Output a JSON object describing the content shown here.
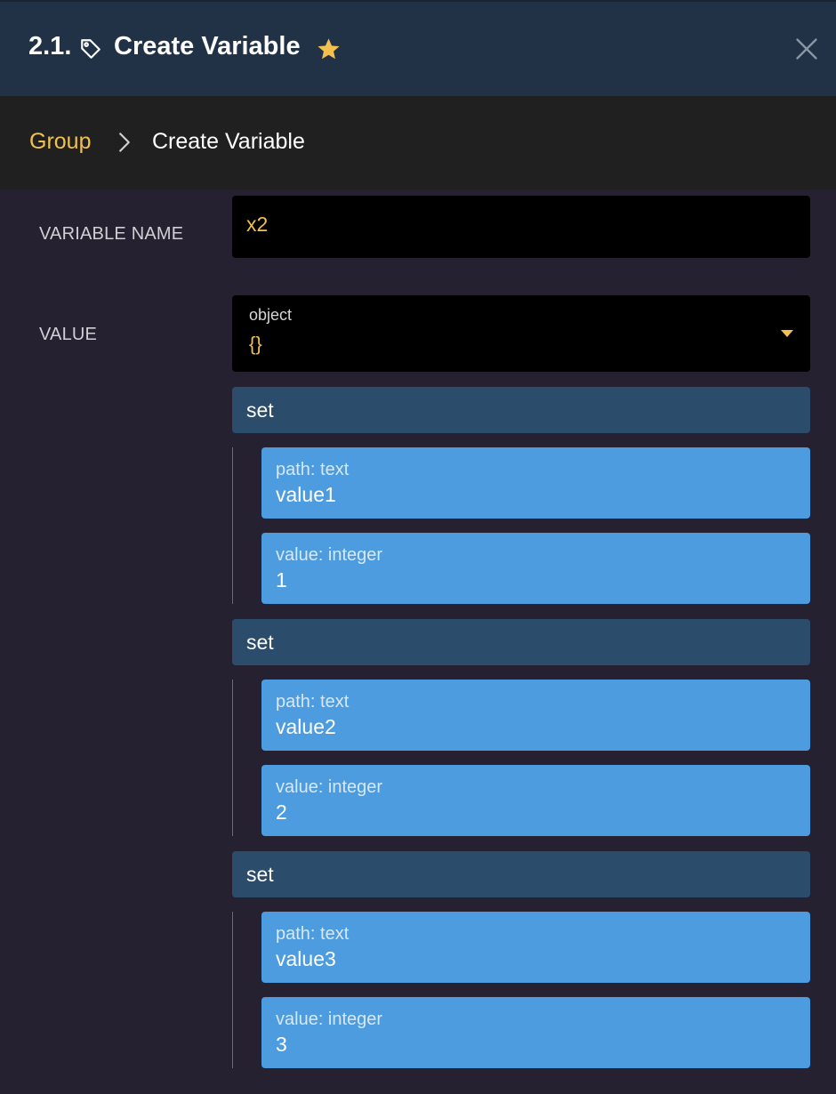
{
  "header": {
    "step_number": "2.1.",
    "title": "Create Variable",
    "icons": {
      "tag": "tag-icon",
      "star": "star-icon",
      "close": "close-icon"
    },
    "colors": {
      "background": "#223246",
      "star": "#f2c04f"
    }
  },
  "breadcrumb": {
    "parent": "Group",
    "current": "Create Variable",
    "separator_icon": "chevron-right-icon"
  },
  "form": {
    "variable_name_label": "VARIABLE NAME",
    "variable_name_value": "x2",
    "value_label": "VALUE",
    "value_type": "object",
    "value_display": "{}",
    "value_dropdown_icon": "caret-down-icon",
    "operations": [
      {
        "label": "set",
        "path_caption": "path: text",
        "path_value": "value1",
        "value_caption": "value: integer",
        "value_value": "1"
      },
      {
        "label": "set",
        "path_caption": "path: text",
        "path_value": "value2",
        "value_caption": "value: integer",
        "value_value": "2"
      },
      {
        "label": "set",
        "path_caption": "path: text",
        "path_value": "value3",
        "value_caption": "value: integer",
        "value_value": "3"
      }
    ]
  },
  "colors": {
    "accent": "#f2c04f",
    "panel_background": "#262130",
    "set_bar": "#2c4c6c",
    "field": "#4c9cdf"
  }
}
